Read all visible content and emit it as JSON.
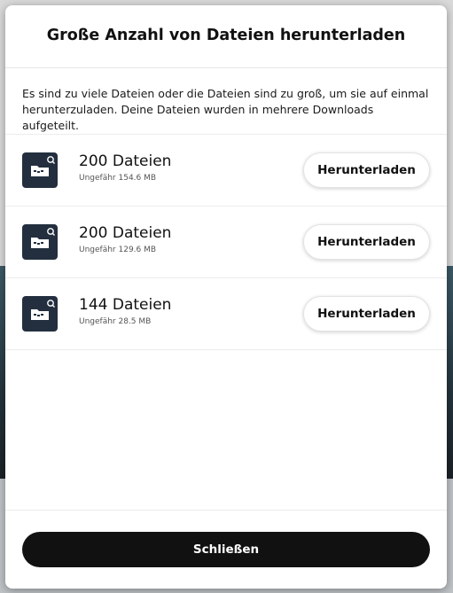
{
  "dialog": {
    "title": "Große Anzahl von Dateien herunterladen",
    "intro": "Es sind zu viele Dateien oder die Dateien sind zu groß, um sie auf einmal herunterzuladen. Deine Dateien wurden in mehrere Downloads aufgeteilt.",
    "items": [
      {
        "count": "200 Dateien",
        "size": "Ungefähr 154.6 MB",
        "button_label": "Herunterladen",
        "icon": "folder-search-icon"
      },
      {
        "count": "200 Dateien",
        "size": "Ungefähr 129.6 MB",
        "button_label": "Herunterladen",
        "icon": "folder-search-icon"
      },
      {
        "count": "144 Dateien",
        "size": "Ungefähr 28.5 MB",
        "button_label": "Herunterladen",
        "icon": "folder-search-icon"
      }
    ],
    "close_label": "Schließen"
  },
  "colors": {
    "tile": "#232f3e",
    "close_button": "#111111",
    "modal_bg": "#ffffff"
  }
}
